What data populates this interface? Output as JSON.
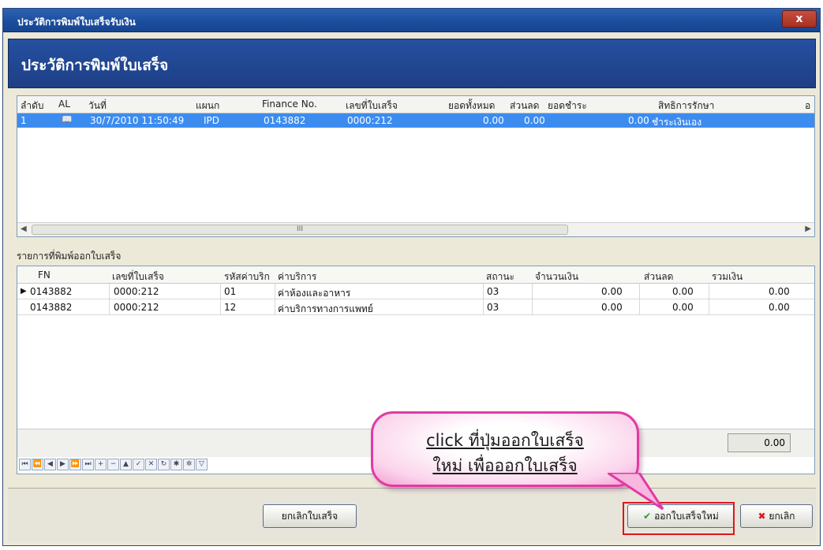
{
  "window": {
    "title": "ประวัติการพิมพ์ใบเสร็จรับเงิน",
    "close_label": "x"
  },
  "header": {
    "title": "ประวัติการพิมพ์ใบเสร็จ"
  },
  "history_grid": {
    "columns": [
      "ลำดับ",
      "AL",
      "วันที่",
      "แผนก",
      "Finance No.",
      "เลขที่ใบเสร็จ",
      "ยอดทั้งหมด",
      "ส่วนลด",
      "ยอดชำระ",
      "สิทธิการรักษา",
      "อ"
    ],
    "rows": [
      {
        "seq": "1",
        "date": "30/7/2010 11:50:49",
        "dept": "IPD",
        "finance_no": "0143882",
        "receipt_no": "0000:212",
        "total": "0.00",
        "discount": "0.00",
        "paid": "0.00",
        "right": "ชำระเงินเอง"
      }
    ],
    "scroll_mark": "III"
  },
  "section_label": "รายการที่พิมพ์ออกใบเสร็จ",
  "detail_grid": {
    "columns": [
      "FN",
      "เลขที่ใบเสร็จ",
      "รหัสค่าบริก",
      "ค่าบริการ",
      "สถานะ",
      "จำนวนเงิน",
      "ส่วนลด",
      "รวมเงิน"
    ],
    "rows": [
      {
        "fn": "0143882",
        "receipt_no": "0000:212",
        "code": "01",
        "service": "ค่าห้องและอาหาร",
        "status": "03",
        "amount": "0.00",
        "discount": "0.00",
        "total": "0.00"
      },
      {
        "fn": "0143882",
        "receipt_no": "0000:212",
        "code": "12",
        "service": "ค่าบริการทางการแพทย์",
        "status": "03",
        "amount": "0.00",
        "discount": "0.00",
        "total": "0.00"
      }
    ],
    "grand_total": "0.00"
  },
  "buttons": {
    "cancel_receipt": "ยกเลิกใบเสร็จ",
    "new_receipt": "ออกใบเสร็จใหม่",
    "cancel": "ยกเลิก"
  },
  "callout": {
    "line1": "click ที่ปุ่มออกใบเสร็จ",
    "line2": "ใหม่ เพื่อออกใบเสร็จ"
  },
  "colors": {
    "accent": "#3c8cf0",
    "header": "#1e3f86",
    "callout_border": "#e13aa4",
    "highlight": "#e0141e"
  }
}
